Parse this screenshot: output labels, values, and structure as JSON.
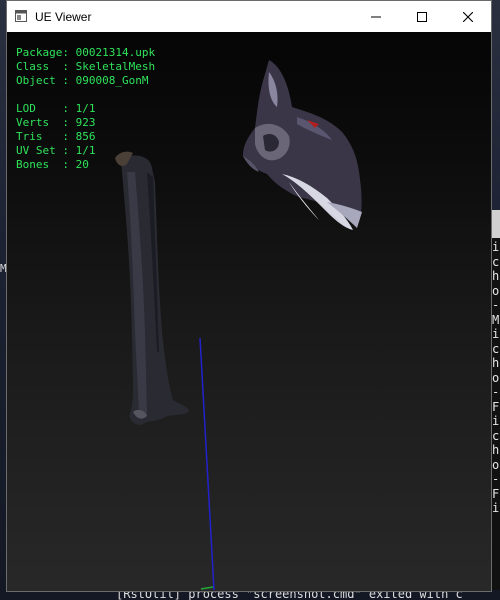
{
  "window": {
    "title": "UE Viewer",
    "icons": {
      "app": "app-window-icon",
      "minimize": "minimize-icon",
      "maximize": "maximize-icon",
      "close": "close-icon"
    }
  },
  "overlay": {
    "package_label": "Package:",
    "package_value": "00021314.upk",
    "class_label": "Class  :",
    "class_value": "SkeletalMesh",
    "object_label": "Object :",
    "object_value": "090008_GonM",
    "lod_label": "LOD    :",
    "lod_value": "1/1",
    "verts_label": "Verts  :",
    "verts_value": "923",
    "tris_label": "Tris   :",
    "tris_value": "856",
    "uvset_label": "UV Set :",
    "uvset_value": "1/1",
    "bones_label": "Bones  :",
    "bones_value": "20"
  },
  "background": {
    "left_char": "M",
    "side_panel_lines": [
      "i",
      "c",
      "h",
      "o",
      "-",
      "",
      "M",
      "i",
      "c",
      "h",
      "o",
      "-",
      "",
      "F",
      "i",
      "c",
      "h",
      "o",
      "-",
      "",
      "F",
      "i"
    ],
    "bottom_text": "[RstUtil] process \"screenshot.cmd\" exited with c"
  },
  "colors": {
    "overlay_text": "#2fe35a",
    "axis_line": "#2222cc"
  }
}
